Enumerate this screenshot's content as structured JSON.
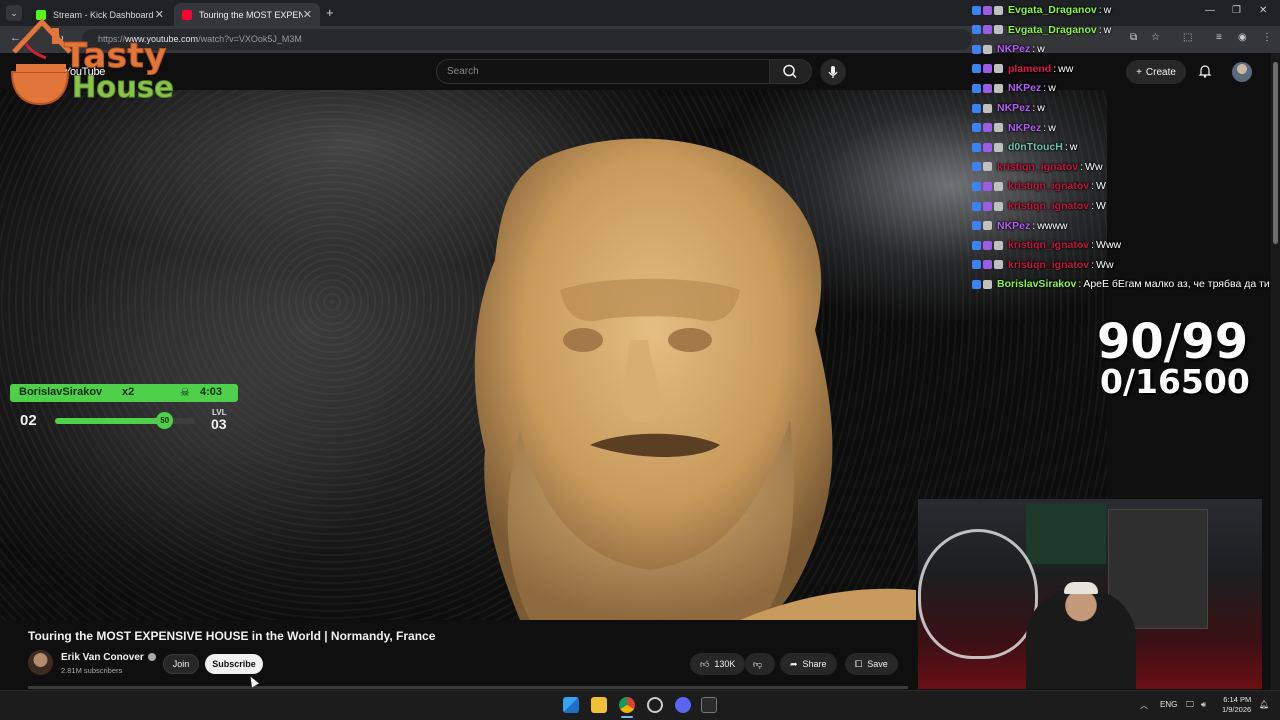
{
  "browser": {
    "tabs": [
      {
        "label": "Stream - Kick Dashboard",
        "favicon": "kick-icon",
        "color": "#53fc18"
      },
      {
        "label": "Touring the MOST EXPENSIVE H",
        "favicon": "youtube-icon",
        "color": "#ff0033"
      }
    ],
    "url_prefix": "https://",
    "url_host": "www.youtube.com",
    "url_path": "/watch?v=VXOok5J_M3M"
  },
  "youtube": {
    "logo_text": "YouTube",
    "search_placeholder": "Search",
    "create_label": "Create"
  },
  "overlay": {
    "logo_top": "Tasty",
    "logo_bottom": "House",
    "counter_main": "90/99",
    "counter_sub": "0/16500",
    "chat": [
      {
        "user": "Evgata_Draganov",
        "msg": "w",
        "color": "#8bf34a"
      },
      {
        "user": "Evgata_Draganov",
        "msg": "w",
        "color": "#8bf34a"
      },
      {
        "user": "NKPez",
        "msg": "w",
        "color": "#b15ef5"
      },
      {
        "user": "plamend",
        "msg": "ww",
        "color": "#e0154e"
      },
      {
        "user": "NKPez",
        "msg": "w",
        "color": "#b15ef5"
      },
      {
        "user": "NKPez",
        "msg": "w",
        "color": "#b15ef5"
      },
      {
        "user": "NKPez",
        "msg": "w",
        "color": "#b15ef5"
      },
      {
        "user": "d0nTtoucH",
        "msg": "w",
        "color": "#6fc1a8"
      },
      {
        "user": "kristiqn_ignatov",
        "msg": "Ww",
        "color": "#c2163f"
      },
      {
        "user": "kristiqn_ignatov",
        "msg": "W",
        "color": "#c2163f"
      },
      {
        "user": "kristiqn_ignatov",
        "msg": "W",
        "color": "#c2163f"
      },
      {
        "user": "NKPez",
        "msg": "wwww",
        "color": "#b15ef5"
      },
      {
        "user": "kristiqn_ignatov",
        "msg": "Www",
        "color": "#c2163f"
      },
      {
        "user": "kristiqn_ignatov",
        "msg": "Ww",
        "color": "#c2163f"
      },
      {
        "user": "BorislavSirakov",
        "msg": "АреЕ бЕгам малко аз, че трябва да ти",
        "color": "#8bf34a"
      }
    ],
    "level": {
      "user": "BorislavSirakov",
      "multiplier": "x2",
      "time": "4:03",
      "current": "02",
      "progress_value": "50",
      "progress_fraction": 0.78,
      "next_label": "LVL",
      "next": "03"
    }
  },
  "video": {
    "title": "Touring the MOST EXPENSIVE HOUSE in the World | Normandy, France",
    "channel": "Erik Van Conover",
    "subscribers": "2.81M subscribers",
    "join_label": "Join",
    "subscribe_label": "Subscribe",
    "likes": "130K",
    "share_label": "Share",
    "save_label": "Save"
  },
  "taskbar": {
    "lang": "ENG",
    "time": "6:14 PM",
    "date": "1/9/2026"
  }
}
